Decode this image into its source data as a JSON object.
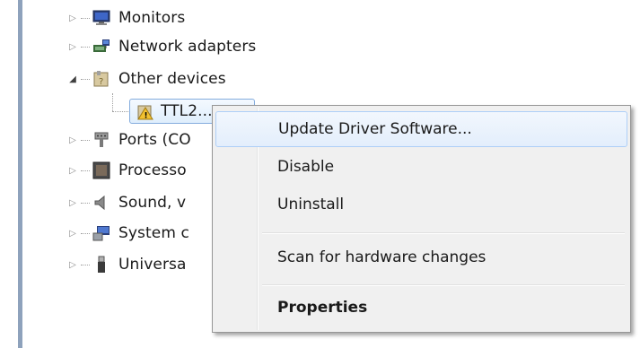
{
  "tree": {
    "items": [
      {
        "label": "Monitors",
        "expander": "▷",
        "icon": "monitor-icon"
      },
      {
        "label": "Network adapters",
        "expander": "▷",
        "icon": "network-adapter-icon"
      },
      {
        "label": "Other devices",
        "expander": "◢",
        "icon": "other-devices-icon"
      },
      {
        "label": "TTL2...",
        "icon": "unknown-device-warning-icon"
      },
      {
        "label": "Ports (CO",
        "expander": "▷",
        "icon": "port-icon"
      },
      {
        "label": "Processo",
        "expander": "▷",
        "icon": "processor-icon"
      },
      {
        "label": "Sound, v",
        "expander": "▷",
        "icon": "speaker-icon"
      },
      {
        "label": "System c",
        "expander": "▷",
        "icon": "system-device-icon"
      },
      {
        "label": "Universa",
        "expander": "▷",
        "icon": "usb-icon"
      }
    ]
  },
  "context_menu": {
    "items": [
      {
        "label": "Update Driver Software...",
        "state": "highlighted"
      },
      {
        "label": "Disable"
      },
      {
        "label": "Uninstall"
      },
      {
        "label": "Scan for hardware changes"
      },
      {
        "label": "Properties",
        "style": "bold"
      }
    ]
  },
  "colors": {
    "selection_border": "#84acdd",
    "menu_background": "#f0f0f0",
    "menu_highlight_border": "#aecff7",
    "frame_border": "#8ea2bc"
  }
}
